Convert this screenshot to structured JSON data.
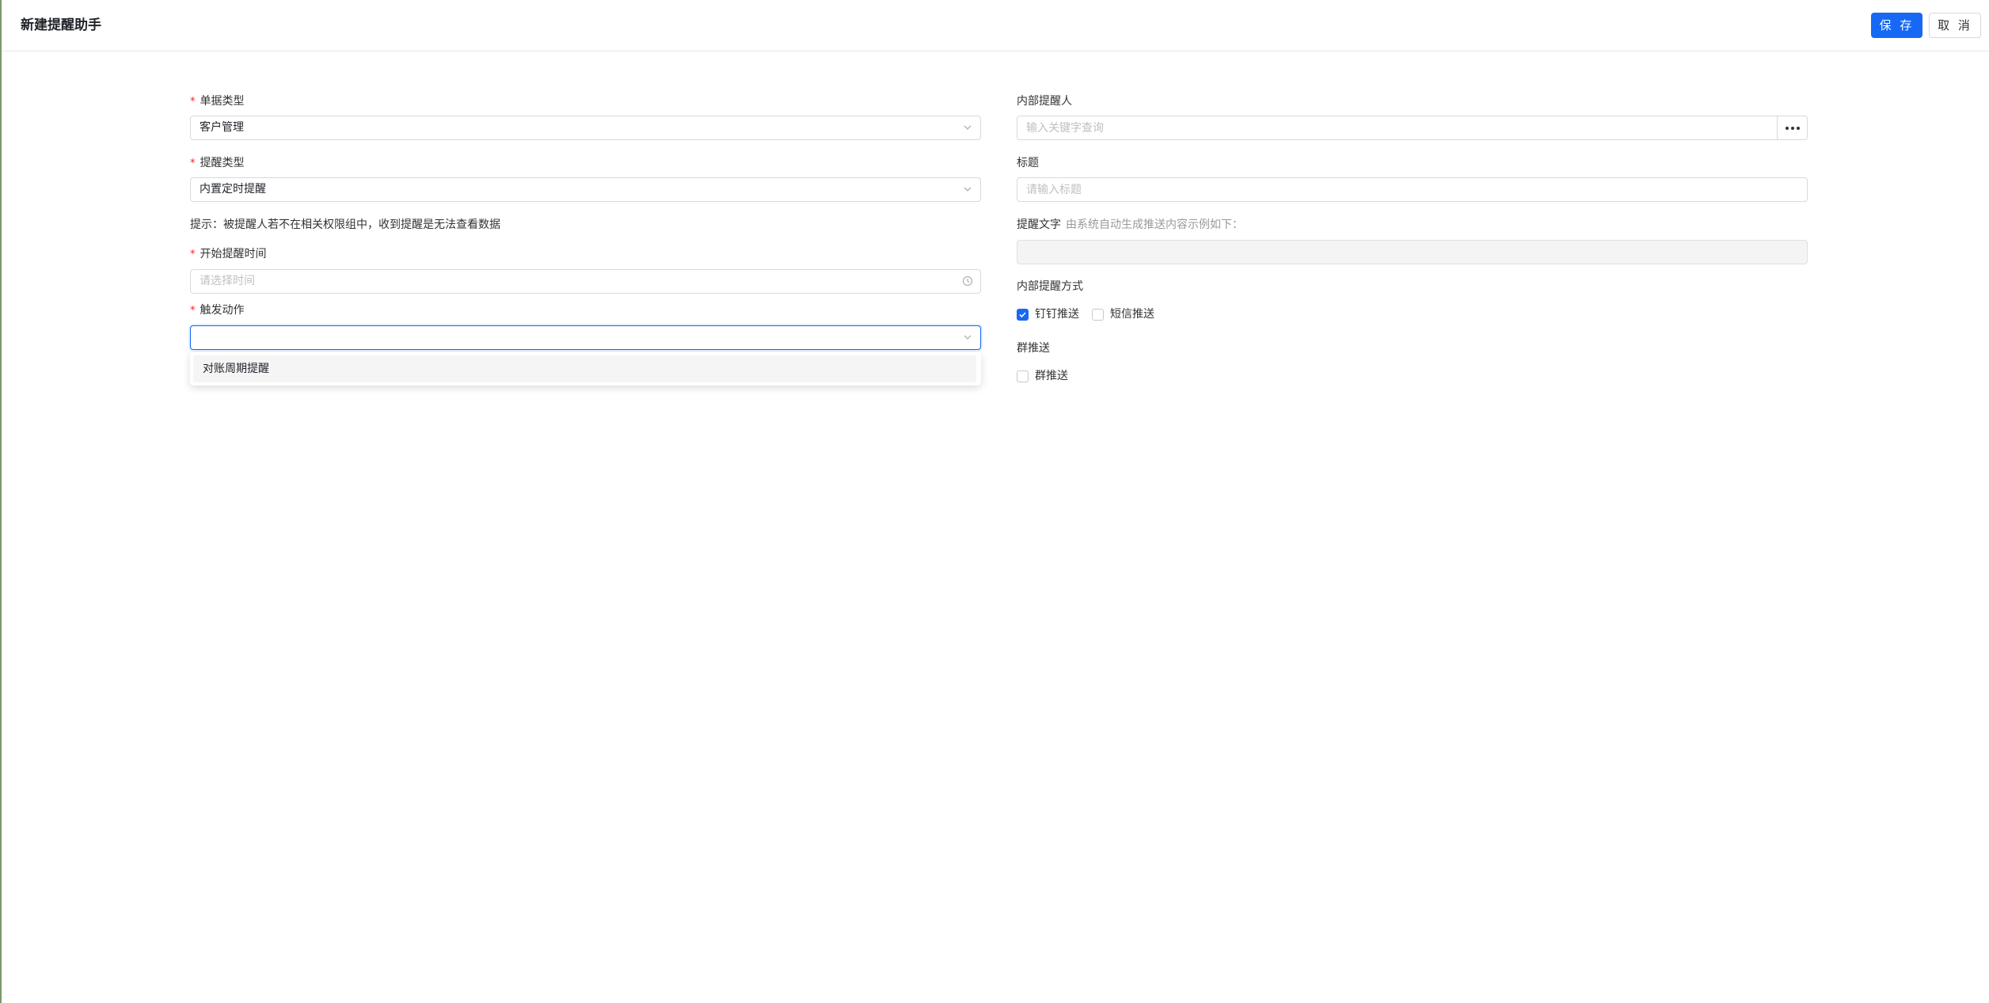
{
  "header": {
    "title": "新建提醒助手",
    "save_label": "保 存",
    "cancel_label": "取 消"
  },
  "left": {
    "doc_type": {
      "label": "单据类型",
      "value": "客户管理"
    },
    "remind_type": {
      "label": "提醒类型",
      "value": "内置定时提醒"
    },
    "tip": "提示：被提醒人若不在相关权限组中，收到提醒是无法查看数据",
    "start_time": {
      "label": "开始提醒时间",
      "placeholder": "请选择时间"
    },
    "trigger": {
      "label": "触发动作",
      "value": ""
    },
    "trigger_options": [
      "对账周期提醒"
    ]
  },
  "right": {
    "recipient": {
      "label": "内部提醒人",
      "placeholder": "输入关键字查询"
    },
    "title_field": {
      "label": "标题",
      "placeholder": "请输入标题"
    },
    "remind_text": {
      "label": "提醒文字",
      "hint": "由系统自动生成推送内容示例如下：",
      "value": ""
    },
    "method": {
      "label": "内部提醒方式",
      "options": [
        {
          "label": "钉钉推送",
          "checked": true
        },
        {
          "label": "短信推送",
          "checked": false
        }
      ]
    },
    "group_push": {
      "label": "群推送",
      "options": [
        {
          "label": "群推送",
          "checked": false
        }
      ]
    }
  },
  "colors": {
    "primary": "#1668f5",
    "required": "#f5222d"
  },
  "icons": [
    "chevron-down-icon",
    "clock-icon",
    "more-icon",
    "checkmark-icon"
  ]
}
